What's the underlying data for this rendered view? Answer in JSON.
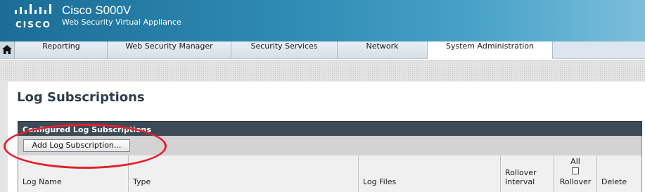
{
  "header": {
    "logo_text": "CISCO",
    "product_name": "Cisco S000V",
    "product_subtitle": "Web Security Virtual Appliance",
    "accent": "#2f8bb4"
  },
  "nav": {
    "home_icon": "home-icon",
    "tabs": [
      {
        "label": "Reporting",
        "active": false
      },
      {
        "label": "Web Security Manager",
        "active": false
      },
      {
        "label": "Security Services",
        "active": false
      },
      {
        "label": "Network",
        "active": false
      },
      {
        "label": "System Administration",
        "active": true
      }
    ]
  },
  "page": {
    "title": "Log Subscriptions",
    "panel_title": "Configured Log Subscriptions",
    "add_button": "Add Log Subscription...",
    "columns": {
      "log_name": "Log Name",
      "type": "Type",
      "log_files": "Log Files",
      "rollover_interval_1": "Rollover",
      "rollover_interval_2": "Interval",
      "all": "All",
      "rollover": "Rollover",
      "delete": "Delete"
    },
    "all_checkbox_checked": false,
    "highlight_color": "#e3202a"
  }
}
